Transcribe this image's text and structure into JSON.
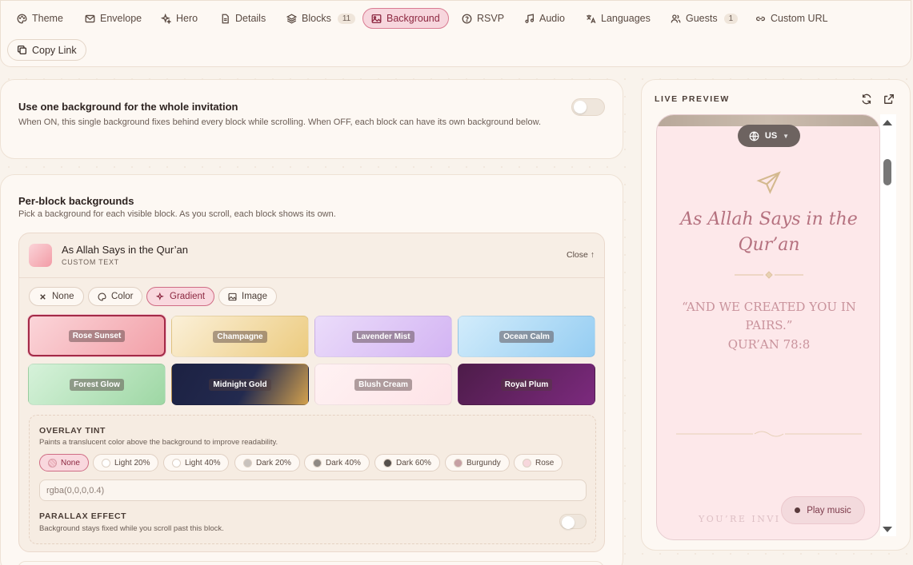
{
  "tabs": [
    {
      "label": "Theme",
      "icon": "palette-icon"
    },
    {
      "label": "Envelope",
      "icon": "envelope-icon"
    },
    {
      "label": "Hero",
      "icon": "sparkles-icon"
    },
    {
      "label": "Details",
      "icon": "document-icon"
    },
    {
      "label": "Blocks",
      "icon": "layers-icon",
      "badge": "11"
    },
    {
      "label": "Background",
      "icon": "image-icon",
      "active": true
    },
    {
      "label": "RSVP",
      "icon": "question-circle-icon"
    },
    {
      "label": "Audio",
      "icon": "music-note-icon"
    },
    {
      "label": "Languages",
      "icon": "translate-icon"
    },
    {
      "label": "Guests",
      "icon": "users-icon",
      "badge": "1"
    },
    {
      "label": "Custom URL",
      "icon": "link-icon"
    }
  ],
  "copy_link": "Copy Link",
  "global_bg": {
    "title": "Use one background for the whole invitation",
    "description": "When ON, this single background fixes behind every block while scrolling. When OFF, each block can have its own background below.",
    "enabled": false
  },
  "per_block": {
    "title": "Per-block backgrounds",
    "description": "Pick a background for each visible block. As you scroll, each block shows its own.",
    "block": {
      "name": "As Allah Says in the Qur’an",
      "type": "CUSTOM TEXT",
      "close": "Close ↑"
    },
    "bg_options": [
      "None",
      "Color",
      "Gradient",
      "Image"
    ],
    "selected_option": "Gradient",
    "gradients": [
      {
        "name": "Rose Sunset",
        "from": "#fbd5d9",
        "to": "#f2a0a8",
        "selected": true
      },
      {
        "name": "Champagne",
        "from": "#fbf0d8",
        "to": "#eccb7f"
      },
      {
        "name": "Lavender Mist",
        "from": "#ebdcfa",
        "to": "#d3b4f3"
      },
      {
        "name": "Ocean Calm",
        "from": "#d2ecfb",
        "to": "#95cdf2"
      },
      {
        "name": "Forest Glow",
        "from": "#d6f2da",
        "to": "#9ed7a4"
      },
      {
        "name": "Midnight Gold",
        "from": "#1c2142",
        "to": "#d3a14e"
      },
      {
        "name": "Blush Cream",
        "from": "#fff2f3",
        "to": "#fde3e7"
      },
      {
        "name": "Royal Plum",
        "from": "#4d1c49",
        "to": "#7c2a7e"
      }
    ],
    "overlay": {
      "title": "OVERLAY TINT",
      "description": "Paints a translucent color above the background to improve readability.",
      "options": [
        {
          "label": "None",
          "color": "none",
          "active": true
        },
        {
          "label": "Light 20%",
          "color": "#ffffff"
        },
        {
          "label": "Light 40%",
          "color": "#ffffff"
        },
        {
          "label": "Dark 20%",
          "color": "#c8c2bd"
        },
        {
          "label": "Dark 40%",
          "color": "#8e8984"
        },
        {
          "label": "Dark 60%",
          "color": "#55504c"
        },
        {
          "label": "Burgundy",
          "color": "#c6a0a4"
        },
        {
          "label": "Rose",
          "color": "#f7d7dc"
        }
      ],
      "value": "rgba(0,0,0,0.4)"
    },
    "parallax": {
      "title": "PARALLAX EFFECT",
      "description": "Background stays fixed while you scroll past this block.",
      "enabled": false
    }
  },
  "preview": {
    "label": "LIVE PREVIEW",
    "language": "US",
    "heading": "As Allah Says in the Qur’an",
    "quote": "“AND WE CREATED YOU IN PAIRS.”",
    "reference": "QUR’AN 78:8",
    "footer_text": "YOU’RE INVI",
    "play_music": "Play music"
  },
  "colors": {
    "accent": "#8c2740",
    "accent_bg": "#f7d6dd",
    "preview_heading": "#b5717f",
    "preview_quote": "#c9939c"
  }
}
